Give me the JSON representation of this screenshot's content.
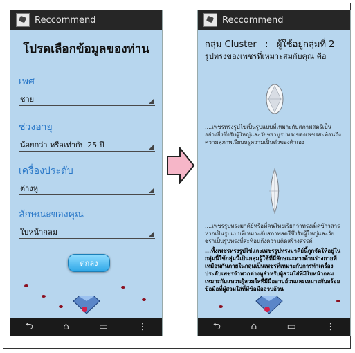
{
  "app": {
    "title": "Reccommend"
  },
  "left_screen": {
    "heading": "โปรดเลือกข้อมูลของท่าน",
    "sections": [
      {
        "label": "เพศ",
        "value": "ชาย"
      },
      {
        "label": "ช่วงอายุ",
        "value": "น้อยกว่า หรือเท่ากับ 25 ปี"
      },
      {
        "label": "เครื่องประดับ",
        "value": "ต่างหู"
      },
      {
        "label": "ลักษณะของคุณ",
        "value": "ใบหน้ากลม"
      }
    ],
    "submit_label": "ตกลง"
  },
  "right_screen": {
    "cluster_line": "กลุ่ม Cluster   :   ผู้ใช้อยู่กลุ่มที่ 2",
    "subtitle": "รูปทรงของเพชรที่เหมาะสมกับคุณ  คือ",
    "paragraphs": [
      "....เพชรทรงรูปไข่เป็นรูปแบบที่เหมาะกับสภาพสตรีเป็นอย่างยิ่งซึ่งรับผู้ใหญ่และวัยชราบูรปทรงของเพชรสะท้อนถึงความสุภาพเรียบหรูความเป็นตัวของตัวเอง",
      "....เพชรรูปทรงมาคีย์หรือที่คนไทยเรียกว่าทรงเม็ดข้าวสารหากเป็นรูปแบบที่เหมาะกับสภาพสตรีซึ่งรับผู้ใหญ่และวัยชราเป็นรูปทรงที่สะท้อนถึงความคิดสร้างสรรค์",
      "...ทั้งเพชรทรงรูปไข่และเพชรรูปทรงมาคีย์นี้ถูกจัดให้อยู่ในกลุ่มนี้ใช้กลุ่มนี้เป็นกลุ่มผู้ใช้ที่มีลักษณะทางด้านร่างกายที่เหมือนกันภายในกลุ่มเป็นเพชรที่เหมาะกับการทำเครื่องประดับเพชรจำพวกต่างหูสำหรับผู้สวมใส่ที่มีใบหน้ากลมเหมาะกับแหวนผู้สวมใส่ที่มีมืออวบอ้วนและเหมาะกับสร้อยข้อมือที่ผู้สวมใส่ที่มีข้อมืออวบอ้วน"
    ]
  },
  "nav": {
    "back": "⮌",
    "home": "⌂",
    "recents": "▭",
    "menu": "⋮"
  },
  "colors": {
    "screen_bg": "#b7d6ee",
    "bar": "#262626",
    "label": "#2a78c8",
    "arrow_fill": "#f6b6c8"
  }
}
